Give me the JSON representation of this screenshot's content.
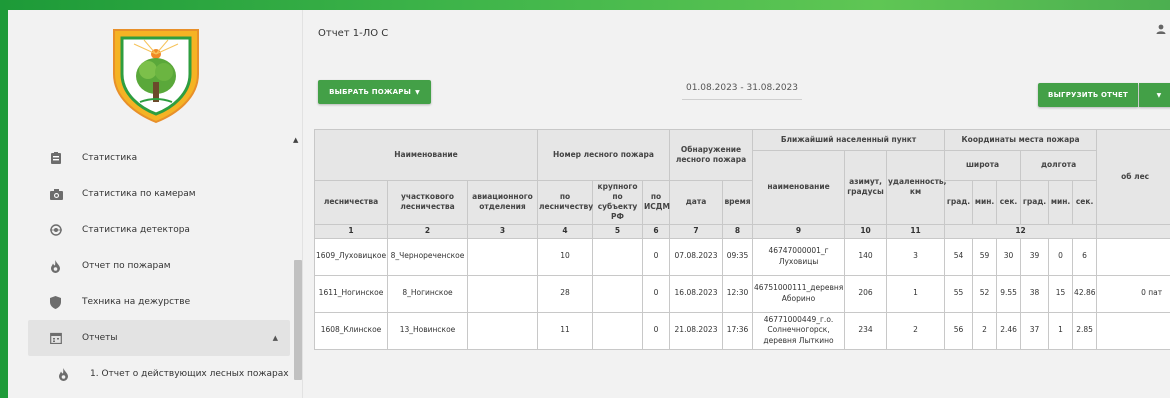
{
  "page": {
    "title": "Отчет 1-ЛО С",
    "select_fires_button": "ВЫБРАТЬ ПОЖАРЫ",
    "date_range": "01.08.2023 - 31.08.2023",
    "export_button": "ВЫГРУЗИТЬ ОТЧЕТ",
    "user_icon": "person-icon"
  },
  "sidebar": {
    "items": [
      {
        "label": "Статистика",
        "icon": "chart-icon"
      },
      {
        "label": "Статистика по камерам",
        "icon": "camera-icon"
      },
      {
        "label": "Статистика детектора",
        "icon": "detector-icon"
      },
      {
        "label": "Отчет по пожарам",
        "icon": "fire-icon"
      },
      {
        "label": "Техника на дежурстве",
        "icon": "shield-icon"
      },
      {
        "label": "Отчеты",
        "icon": "calendar-icon"
      },
      {
        "label": "1. Отчет о действующих лесных пожарах",
        "icon": "fire-icon"
      }
    ]
  },
  "table": {
    "group_headers": {
      "name": "Наименование",
      "fire_number": "Номер лесного пожара",
      "detection": "Обнаружение лесного пожара",
      "settlement": "Ближайший населенный пункт",
      "coordinates": "Координаты места пожара",
      "latitude": "широта",
      "longitude": "долгота",
      "cut_off": "об лес"
    },
    "col_headers": {
      "forestry": "лесничества",
      "district_forestry": "участкового лесничества",
      "aviation_dept": "авиационного отделения",
      "by_forestry": "по лесничеству",
      "large_by_subject": "крупного по субъекту РФ",
      "by_isdm": "по ИСДМ",
      "date": "дата",
      "time": "время",
      "settlement_name": "наименование",
      "azimuth": "азимут, градусы",
      "distance": "удаленность, км",
      "deg": "град.",
      "min": "мин.",
      "sec": "сек."
    },
    "col_numbers": [
      "1",
      "2",
      "3",
      "4",
      "5",
      "6",
      "7",
      "8",
      "9",
      "10",
      "11",
      "12"
    ],
    "rows": [
      {
        "forestry": "1609_Луховицкое",
        "district": "8_Черноречен­ское",
        "aviation": "",
        "by_forestry": "10",
        "large": "",
        "isdm": "0",
        "date": "07.08.2023",
        "time": "09:35",
        "settlement": "46747000001_г Луховицы",
        "azimuth": "140",
        "distance": "3",
        "lat_deg": "54",
        "lat_min": "59",
        "lat_sec": "30",
        "lon_deg": "39",
        "lon_min": "0",
        "lon_sec": "6",
        "extra": ""
      },
      {
        "forestry": "1611_Ногинское",
        "district": "8_Ногинское",
        "aviation": "",
        "by_forestry": "28",
        "large": "",
        "isdm": "0",
        "date": "16.08.2023",
        "time": "12:30",
        "settlement": "46751000111_деревня Аборино",
        "azimuth": "206",
        "distance": "1",
        "lat_deg": "55",
        "lat_min": "52",
        "lat_sec": "9.55",
        "lon_deg": "38",
        "lon_min": "15",
        "lon_sec": "42.86",
        "extra": "0 пат"
      },
      {
        "forestry": "1608_Клинское",
        "district": "13_Новинское",
        "aviation": "",
        "by_forestry": "11",
        "large": "",
        "isdm": "0",
        "date": "21.08.2023",
        "time": "17:36",
        "settlement": "46771000449_г.о. Солнечногорск, деревня Лыткино",
        "azimuth": "234",
        "distance": "2",
        "lat_deg": "56",
        "lat_min": "2",
        "lat_sec": "2.46",
        "lon_deg": "37",
        "lon_min": "1",
        "lon_sec": "2.85",
        "extra": ""
      }
    ]
  }
}
